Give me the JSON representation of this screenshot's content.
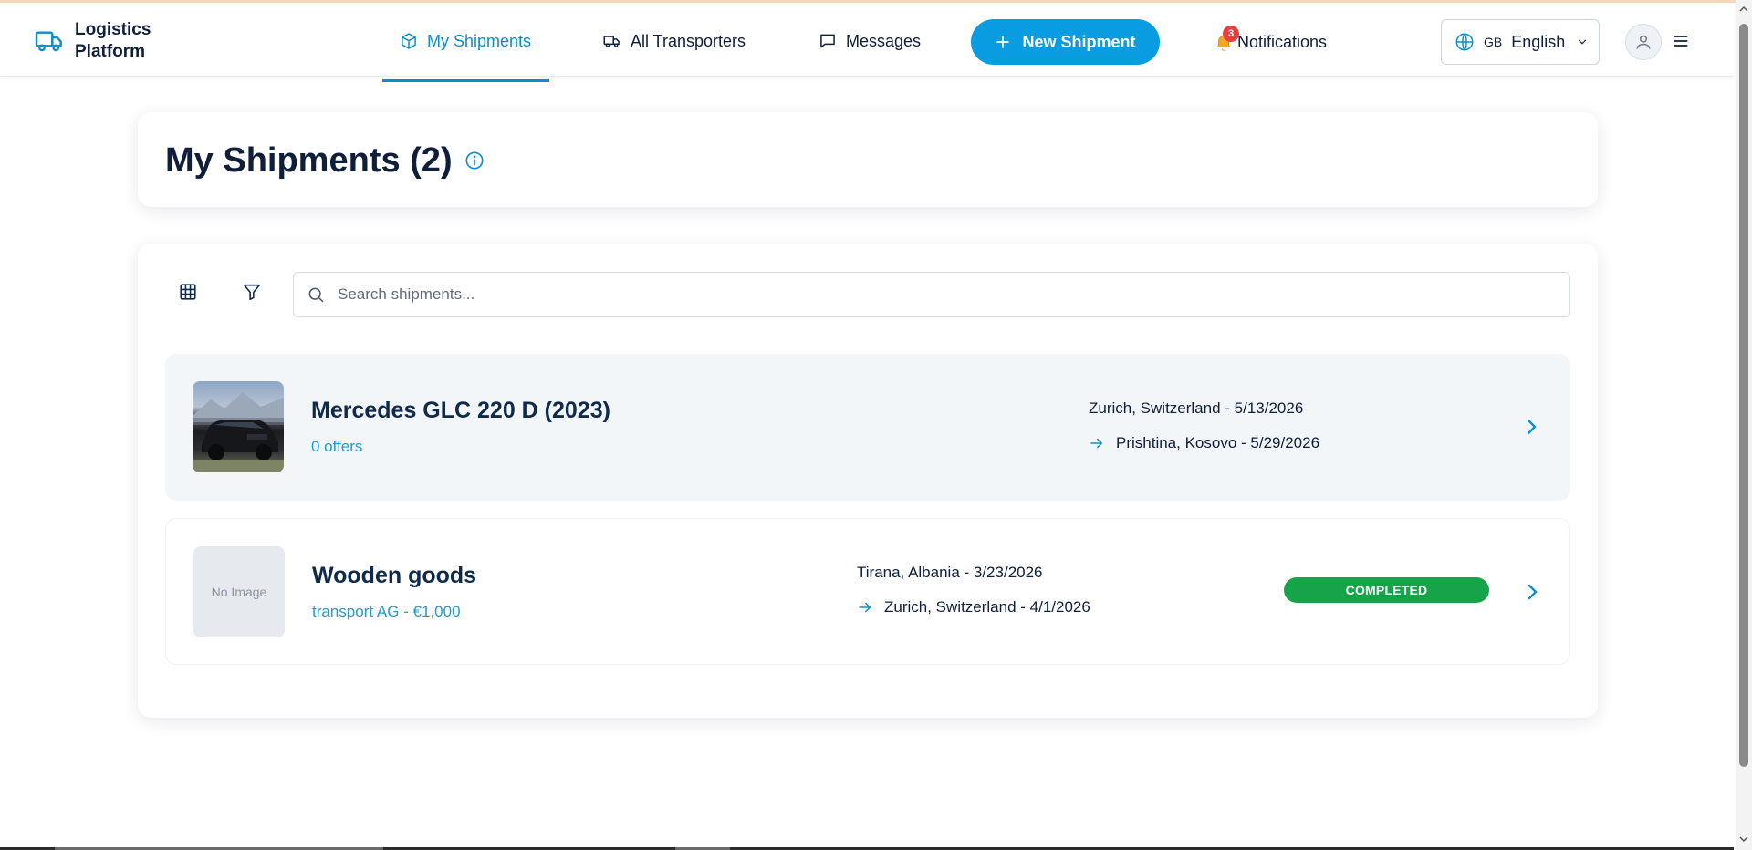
{
  "brand": {
    "line1": "Logistics",
    "line2": "Platform"
  },
  "nav": {
    "my_shipments": "My Shipments",
    "all_transporters": "All Transporters",
    "messages": "Messages",
    "new_shipment": "New Shipment",
    "notifications": "Notifications",
    "notification_count": "3"
  },
  "language": {
    "flag": "GB",
    "label": "English"
  },
  "page": {
    "title": "My Shipments (2)"
  },
  "search": {
    "placeholder": "Search shipments..."
  },
  "shipments": [
    {
      "title": "Mercedes GLC 220 D (2023)",
      "subtitle": "0 offers",
      "from": "Zurich, Switzerland - 5/13/2026",
      "to": "Prishtina, Kosovo - 5/29/2026",
      "image": "car-photo",
      "status": ""
    },
    {
      "title": "Wooden goods",
      "subtitle": "transport AG - €1,000",
      "from": "Tirana, Albania - 3/23/2026",
      "to": "Zurich, Switzerland - 4/1/2026",
      "image_placeholder": "No Image",
      "status": "COMPLETED"
    }
  ],
  "colors": {
    "accent": "#0a9ce0",
    "status_completed": "#16a34a",
    "badge": "#e2413f",
    "text": "#0f1e3a"
  }
}
